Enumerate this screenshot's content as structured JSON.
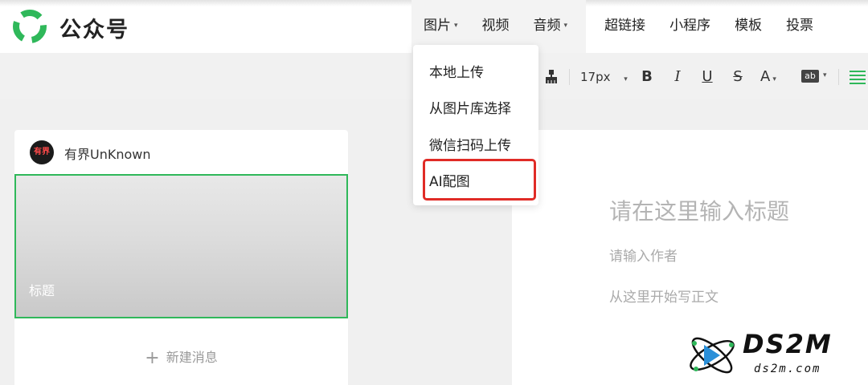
{
  "header": {
    "brand": "公众号",
    "nav_left": [
      {
        "label": "图片",
        "caret": "▾"
      },
      {
        "label": "视频",
        "caret": ""
      },
      {
        "label": "音频",
        "caret": "▾"
      }
    ],
    "nav_right": [
      {
        "label": "超链接"
      },
      {
        "label": "小程序"
      },
      {
        "label": "模板"
      },
      {
        "label": "投票"
      }
    ]
  },
  "toolbar": {
    "font_size": "17px",
    "bold": "B",
    "italic": "I",
    "underline": "U",
    "strike": "S",
    "font_color": "A",
    "highlight": "ab"
  },
  "dropdown": {
    "items": [
      "本地上传",
      "从图片库选择",
      "微信扫码上传",
      "AI配图"
    ],
    "highlight_color": "#e02b26"
  },
  "account": {
    "avatar_text": "有界",
    "name": "有界UnKnown"
  },
  "cover": {
    "title": "标题",
    "border_color": "#2fb85a"
  },
  "new_message": {
    "plus": "+",
    "label": "新建消息"
  },
  "editor": {
    "title_placeholder": "请在这里输入标题",
    "author_placeholder": "请输入作者",
    "body_placeholder": "从这里开始写正文"
  },
  "watermark": {
    "main": "DS2M",
    "sub": "ds2m.com"
  },
  "colors": {
    "brand_green": "#2fb85a",
    "accent_red": "#e02b26"
  }
}
